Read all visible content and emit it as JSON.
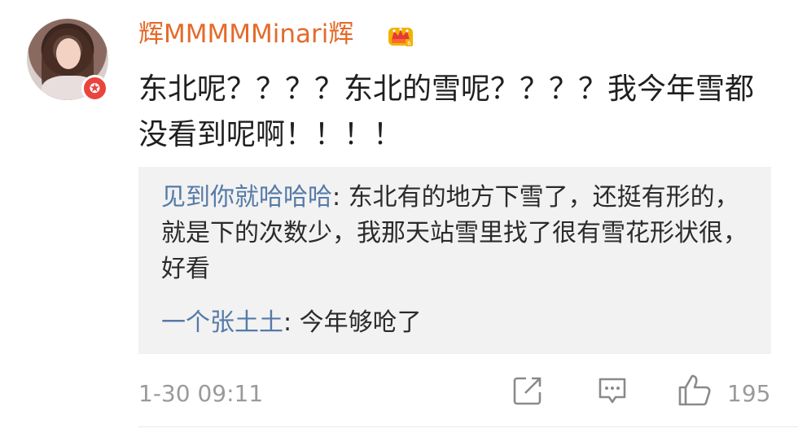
{
  "post": {
    "username": "辉MMMMMinari辉",
    "text": "东北呢？？？？东北的雪呢？？？？我今年雪都没看到呢啊！！！！",
    "time": "1-30 09:11",
    "likes": "195"
  },
  "replies": [
    {
      "author": "见到你就哈哈哈",
      "sep": ": ",
      "text": "东北有的地方下雪了，还挺有形的，就是下的次数少，我那天站雪里找了很有雪花形状很，好看"
    },
    {
      "author": "一个张土土",
      "sep": ": ",
      "text": "今年够呛了"
    }
  ],
  "icons": {
    "vip_badge": "weibo-v-badge-icon",
    "crown": "crown-badge-icon",
    "share": "share-icon",
    "comment": "comment-icon",
    "like": "like-icon"
  },
  "colors": {
    "username": "#e46a2b",
    "reply_author": "#557aa8",
    "meta": "#9a9a9a",
    "reply_bg": "#f2f2f2"
  }
}
